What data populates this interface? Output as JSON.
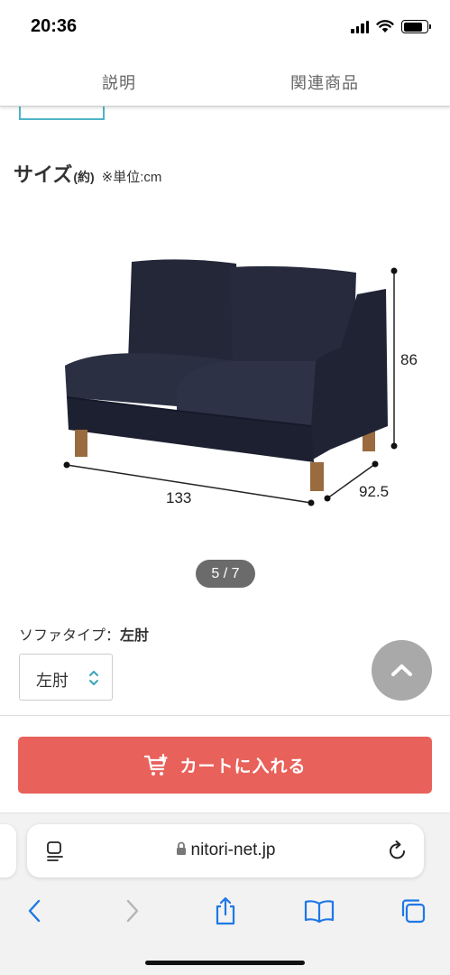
{
  "status": {
    "time": "20:36",
    "battery_level": 0.8
  },
  "tabs": [
    {
      "label": "説明"
    },
    {
      "label": "関連商品"
    }
  ],
  "size_section": {
    "title": "サイズ",
    "approx": "(約)",
    "unit_note": "※単位:cm"
  },
  "product_image": {
    "dims": {
      "width": "133",
      "depth": "92.5",
      "height": "86"
    },
    "counter": "5 / 7",
    "sofa_color": "#262a3d"
  },
  "option": {
    "label": "ソファタイプ：",
    "value_bold": "左肘",
    "select_value": "左肘"
  },
  "cart": {
    "label": "カートに入れる",
    "color": "#e8615a"
  },
  "browser": {
    "url": "nitori-net.jp"
  }
}
